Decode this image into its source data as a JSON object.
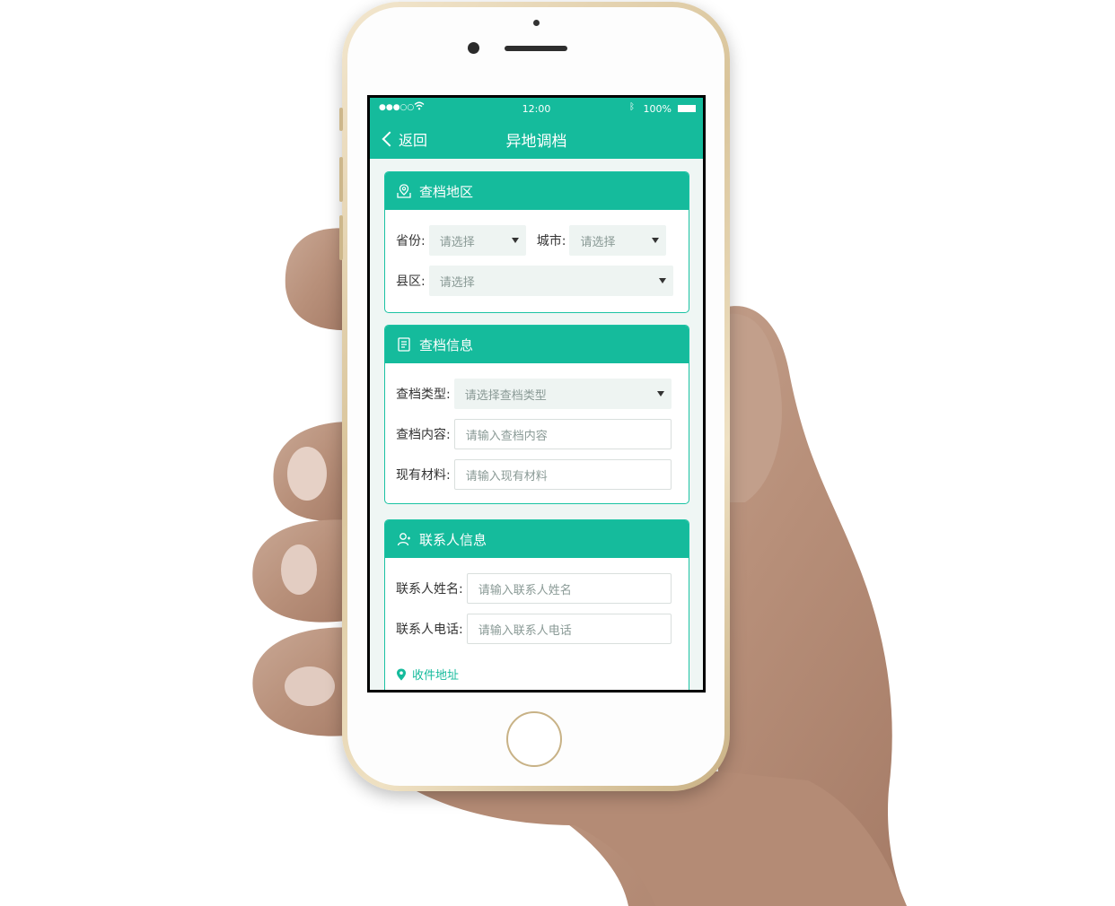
{
  "status_bar": {
    "signal": "●●●○○",
    "time": "12:00",
    "battery_pct": "100%"
  },
  "nav": {
    "back_label": "返回",
    "title": "异地调档"
  },
  "region_card": {
    "title": "查档地区",
    "province_label": "省份:",
    "province_value": "请选择",
    "city_label": "城市:",
    "city_value": "请选择",
    "district_label": "县区:",
    "district_value": "请选择"
  },
  "info_card": {
    "title": "查档信息",
    "type_label": "查档类型:",
    "type_value": "请选择查档类型",
    "content_label": "查档内容:",
    "content_placeholder": "请输入查档内容",
    "material_label": "现有材料:",
    "material_placeholder": "请输入现有材料"
  },
  "contact_card": {
    "title": "联系人信息",
    "name_label": "联系人姓名:",
    "name_placeholder": "请输入联系人姓名",
    "phone_label": "联系人电话:",
    "phone_placeholder": "请输入联系人电话",
    "address_label": "收件地址"
  },
  "colors": {
    "accent": "#15bb9c",
    "background": "#eff6f4"
  },
  "icons": [
    "wifi-icon",
    "bluetooth-icon",
    "battery-icon",
    "back-chevron-icon",
    "location-map-icon",
    "document-icon",
    "contact-person-icon",
    "map-pin-icon"
  ]
}
